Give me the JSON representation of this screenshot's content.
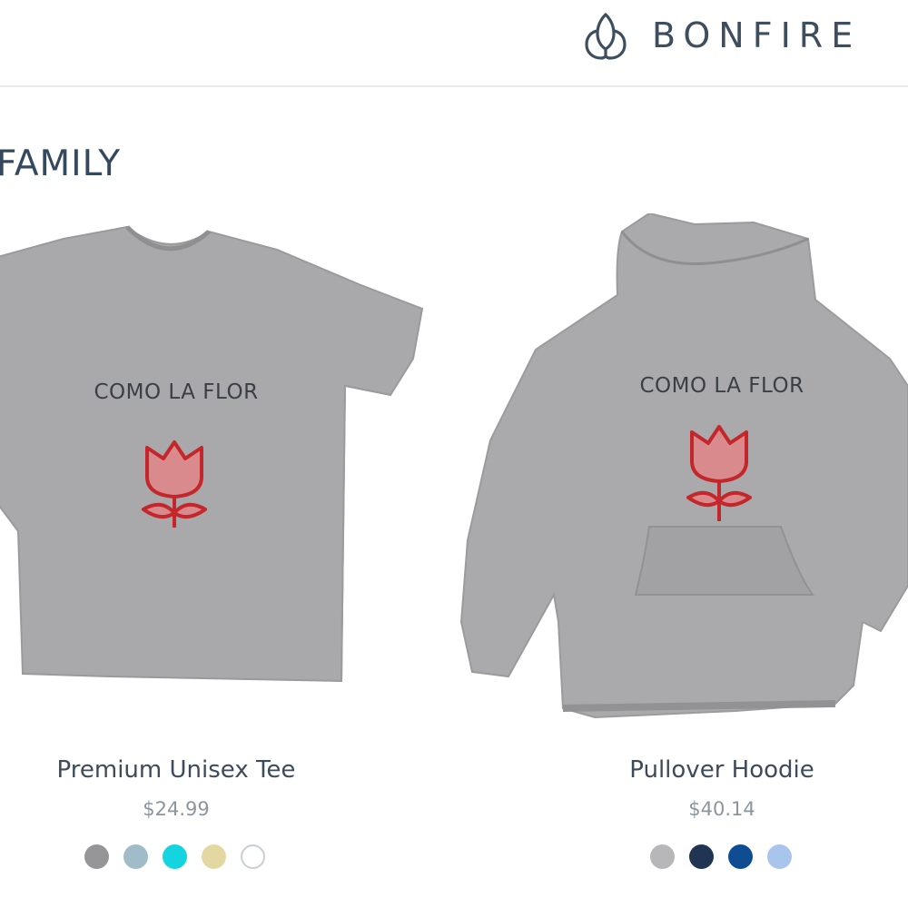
{
  "header": {
    "brand": "BONFIRE",
    "logo_icon": "bonfire-flame-icon"
  },
  "section": {
    "title": "FAMILY"
  },
  "products": [
    {
      "name": "Premium Unisex Tee",
      "price": "$24.99",
      "design_text": "COMO LA FLOR",
      "design_icon": "rose-icon",
      "garment_color": "#a9a9ab",
      "swatches": [
        "#969698",
        "#9fbcc8",
        "#14d4df",
        "#e3d8a2",
        "#ffffff"
      ]
    },
    {
      "name": "Pullover Hoodie",
      "price": "$40.14",
      "design_text": "COMO LA FLOR",
      "design_icon": "rose-icon",
      "garment_color": "#aaaaac",
      "swatches": [
        "#b7b7b9",
        "#1f3553",
        "#0f4d93",
        "#a9c5ec"
      ]
    }
  ],
  "colors": {
    "text_primary": "#34495e",
    "rose_red": "#c4272b"
  }
}
